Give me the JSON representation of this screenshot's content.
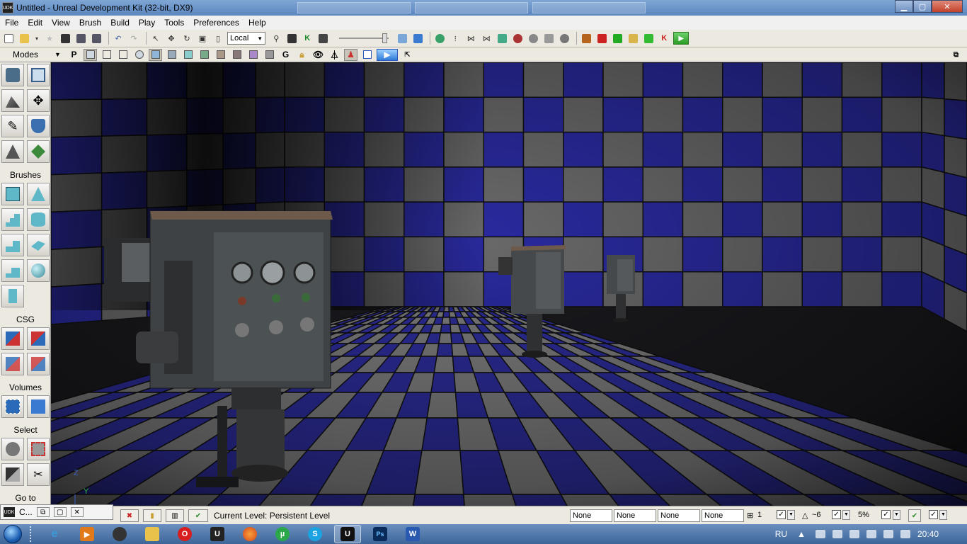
{
  "window": {
    "title": "Untitled - Unreal Development Kit (32-bit, DX9)",
    "app_icon_text": "UDK",
    "buttons": {
      "minimize": "▁",
      "maximize": "▢",
      "close": "✕"
    }
  },
  "menu": {
    "items": [
      "File",
      "Edit",
      "View",
      "Brush",
      "Build",
      "Play",
      "Tools",
      "Preferences",
      "Help"
    ]
  },
  "toolbar": {
    "coord_system": "Local",
    "kismet_icon_letter": "K",
    "play_icon": "play-in-editor-icon"
  },
  "toolbar2": {
    "modes_label": "Modes",
    "perspective_letter": "P",
    "grid_letter": "G"
  },
  "leftpanel": {
    "brushes_label": "Brushes",
    "csg_label": "CSG",
    "volumes_label": "Volumes",
    "select_label": "Select",
    "goto_label": "Go to"
  },
  "viewport": {
    "axis_z": "Z",
    "axis_y": "Y",
    "colors": {
      "floor_blue": "#2c2c9a",
      "floor_gray": "#7c7c7c",
      "wall_blue": "#2a2aa0",
      "wall_gray": "#6a6a6a"
    }
  },
  "statusbar": {
    "mini_title": "C...",
    "current_level_label": "Current Level:  Persistent Level",
    "snap_fields": [
      "None",
      "None",
      "None",
      "None"
    ],
    "grid_value": "1",
    "rotation_value": "~6",
    "scale_value": "5%"
  },
  "taskbar": {
    "language": "RU",
    "time": "20:40",
    "apps": [
      "internet-explorer",
      "media-player",
      "game-app",
      "file-explorer",
      "opera",
      "udk",
      "firefox",
      "utorrent",
      "skype",
      "udk-active",
      "photoshop",
      "word"
    ],
    "letters": {
      "opera": "O",
      "udk": "U",
      "skype": "S",
      "udk-active": "U",
      "photoshop": "Ps",
      "word": "W"
    }
  }
}
